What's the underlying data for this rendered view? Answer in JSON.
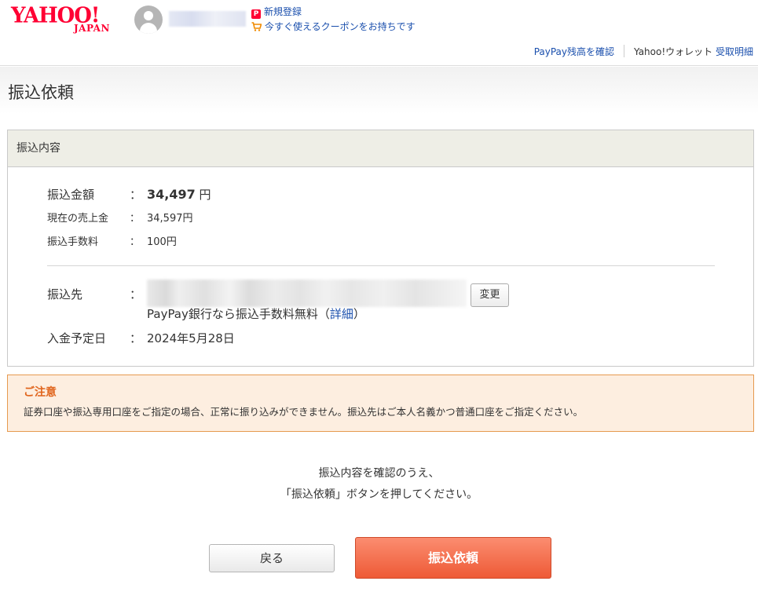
{
  "header": {
    "logo_main": "YAHOO!",
    "logo_sub": "JAPAN",
    "register_link": "新規登録",
    "coupon_link": "今すぐ使えるクーポンをお持ちです",
    "paypay_balance_link": "PayPay残高を確認",
    "wallet_label": "Yahoo!ウォレット",
    "statement_link": "受取明細"
  },
  "page": {
    "title": "振込依頼"
  },
  "details": {
    "heading": "振込内容",
    "colon": "：",
    "amount": {
      "label": "振込金額",
      "value": "34,497",
      "unit": "円"
    },
    "current_sales": {
      "label": "現在の売上金",
      "value": "34,597円"
    },
    "fee": {
      "label": "振込手数料",
      "value": "100円"
    },
    "destination": {
      "label": "振込先",
      "change_button": "変更",
      "note": "PayPay銀行なら振込手数料無料（",
      "note_link": "詳細",
      "note_end": "）"
    },
    "deposit_date": {
      "label": "入金予定日",
      "value": "2024年5月28日"
    }
  },
  "notice": {
    "title": "ご注意",
    "body": "証券口座や振込専用口座をご指定の場合、正常に振り込みができません。振込先はご本人名義かつ普通口座をご指定ください。"
  },
  "instructions": {
    "line1": "振込内容を確認のうえ、",
    "line2": "「振込依頼」ボタンを押してください。"
  },
  "buttons": {
    "back": "戻る",
    "submit": "振込依頼"
  },
  "colors": {
    "brand": "#ff0033",
    "link": "#1a4fad",
    "notice_title": "#e0641c",
    "notice_bg": "#fdeee0",
    "submit_bg": "#ee5a36"
  }
}
